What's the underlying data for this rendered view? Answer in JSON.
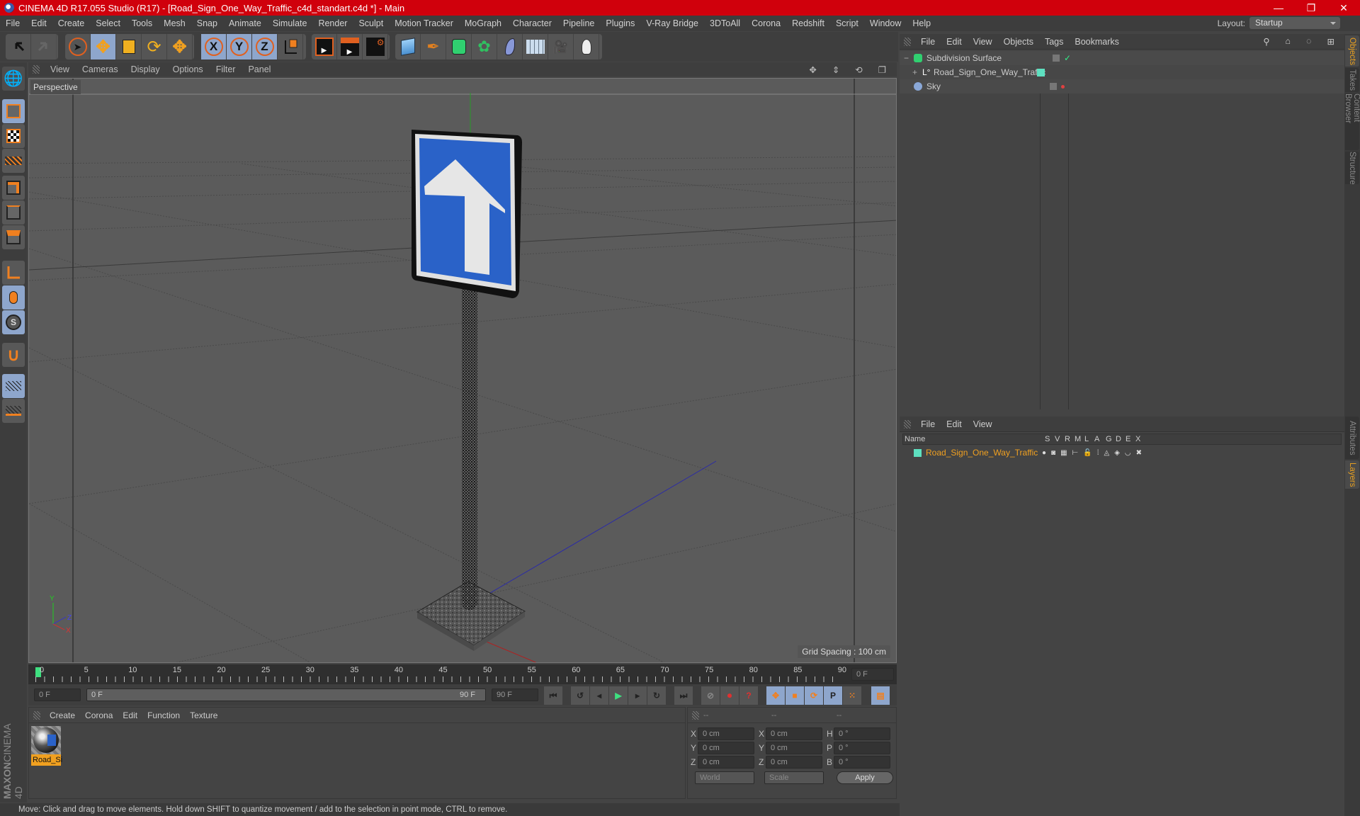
{
  "window": {
    "title": "CINEMA 4D R17.055 Studio (R17) - [Road_Sign_One_Way_Traffic_c4d_standart.c4d *] - Main",
    "controls": [
      "minimize",
      "restore",
      "close"
    ]
  },
  "menubar": [
    "File",
    "Edit",
    "Create",
    "Select",
    "Tools",
    "Mesh",
    "Snap",
    "Animate",
    "Simulate",
    "Render",
    "Sculpt",
    "Motion Tracker",
    "MoGraph",
    "Character",
    "Pipeline",
    "Plugins",
    "V-Ray Bridge",
    "3DToAll",
    "Corona",
    "Redshift",
    "Script",
    "Window",
    "Help"
  ],
  "layout": {
    "label": "Layout:",
    "value": "Startup"
  },
  "toolbar": {
    "history": [
      "undo-icon",
      "redo-icon"
    ],
    "tools": [
      "live-selection-icon",
      "move-icon",
      "scale-icon",
      "rotate-icon",
      "recent-tool-icon"
    ],
    "axes": [
      "X",
      "Y",
      "Z"
    ],
    "coord_system": "world-coordinate-icon",
    "render": [
      "render-view-icon",
      "render-picture-viewer-icon",
      "render-settings-icon"
    ],
    "objects": [
      "cube-icon",
      "pen-spline-icon",
      "subdivision-surface-icon",
      "cloner-icon",
      "bend-deformer-icon",
      "floor-icon",
      "camera-icon",
      "light-icon"
    ]
  },
  "left_toolbar": [
    "make-editable-icon",
    "model-mode-icon",
    "texture-mode-icon",
    "workplane-mode-icon",
    "points-mode-icon",
    "edges-mode-icon",
    "polygons-mode-icon",
    "axis-mode-icon",
    "tweak-mode-icon",
    "solo-icon",
    "snap-icon",
    "workplane-lock-icon",
    "workplane-rotate-icon"
  ],
  "viewport": {
    "menu": [
      "View",
      "Cameras",
      "Display",
      "Options",
      "Filter",
      "Panel"
    ],
    "camera_label": "Perspective",
    "grid_spacing": "Grid Spacing : 100 cm",
    "axis_labels": [
      "Y",
      "Z",
      "X"
    ],
    "nav_icons": [
      "pan-icon",
      "dolly-icon",
      "orbit-icon",
      "maximize-icon"
    ]
  },
  "timeline": {
    "ticks": [
      "0",
      "5",
      "10",
      "15",
      "20",
      "25",
      "30",
      "35",
      "40",
      "45",
      "50",
      "55",
      "60",
      "65",
      "70",
      "75",
      "80",
      "85",
      "90"
    ],
    "current_frame": "0 F"
  },
  "playback": {
    "start": "0 F",
    "range_start": "0 F",
    "range_end": "90 F",
    "end": "90 F"
  },
  "materials": {
    "menu": [
      "Create",
      "Corona",
      "Edit",
      "Function",
      "Texture"
    ],
    "items": [
      {
        "label": "Road_Si"
      }
    ]
  },
  "coordinates": {
    "headers": [
      "--",
      "--",
      "--"
    ],
    "rows": [
      {
        "a": "X",
        "av": "0 cm",
        "b": "X",
        "bv": "0 cm",
        "c": "H",
        "cv": "0 °"
      },
      {
        "a": "Y",
        "av": "0 cm",
        "b": "Y",
        "bv": "0 cm",
        "c": "P",
        "cv": "0 °"
      },
      {
        "a": "Z",
        "av": "0 cm",
        "b": "Z",
        "bv": "0 cm",
        "c": "B",
        "cv": "0 °"
      }
    ],
    "mode": "World",
    "transform": "Scale",
    "apply": "Apply"
  },
  "objects": {
    "menu": [
      "File",
      "Edit",
      "View",
      "Objects",
      "Tags",
      "Bookmarks"
    ],
    "items": [
      {
        "name": "Subdivision Surface",
        "expander": "−",
        "check": "✓"
      },
      {
        "name": "Road_Sign_One_Way_Traffic",
        "expander": "+"
      },
      {
        "name": "Sky"
      }
    ]
  },
  "layers": {
    "menu": [
      "File",
      "Edit",
      "View"
    ],
    "columns": [
      "Name",
      "S",
      "V",
      "R",
      "M",
      "L",
      "A",
      "G",
      "D",
      "E",
      "X"
    ],
    "items": [
      {
        "name": "Road_Sign_One_Way_Traffic",
        "color": "#5ee0c0"
      }
    ]
  },
  "right_tabs": {
    "top": [
      "Objects",
      "Takes",
      "Content Browser",
      "Structure"
    ],
    "bottom": [
      "Attributes",
      "Layers"
    ]
  },
  "status": "Move: Click and drag to move elements. Hold down SHIFT to quantize movement / add to the selection in point mode, CTRL to remove.",
  "branding": {
    "line1": "MAXON",
    "line2": "CINEMA 4D"
  },
  "colors": {
    "title_bar": "#d0000c",
    "accent_orange": "#e8a020",
    "active_blue": "#8ea6cc",
    "layer_teal": "#5ee0c0",
    "sign_blue": "#2a62c8"
  }
}
